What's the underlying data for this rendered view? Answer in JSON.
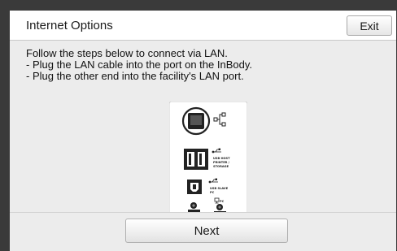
{
  "dialog": {
    "title": "Internet Options",
    "exit_label": "Exit"
  },
  "instructions": {
    "line1": "Follow the steps below to connect via LAN.",
    "line2": "- Plug the LAN cable into the port on the InBody.",
    "line3": "- Plug the other end into the facility's LAN port."
  },
  "port_panel": {
    "usb_host_label_1": "USB HOST",
    "usb_host_label_2": "PRINTER /",
    "usb_host_label_3": "STORAGE",
    "usb_slave_label_1": "USB SLAVE",
    "usb_slave_label_2": "PC",
    "pc_label": "PC"
  },
  "footer": {
    "next_label": "Next"
  }
}
